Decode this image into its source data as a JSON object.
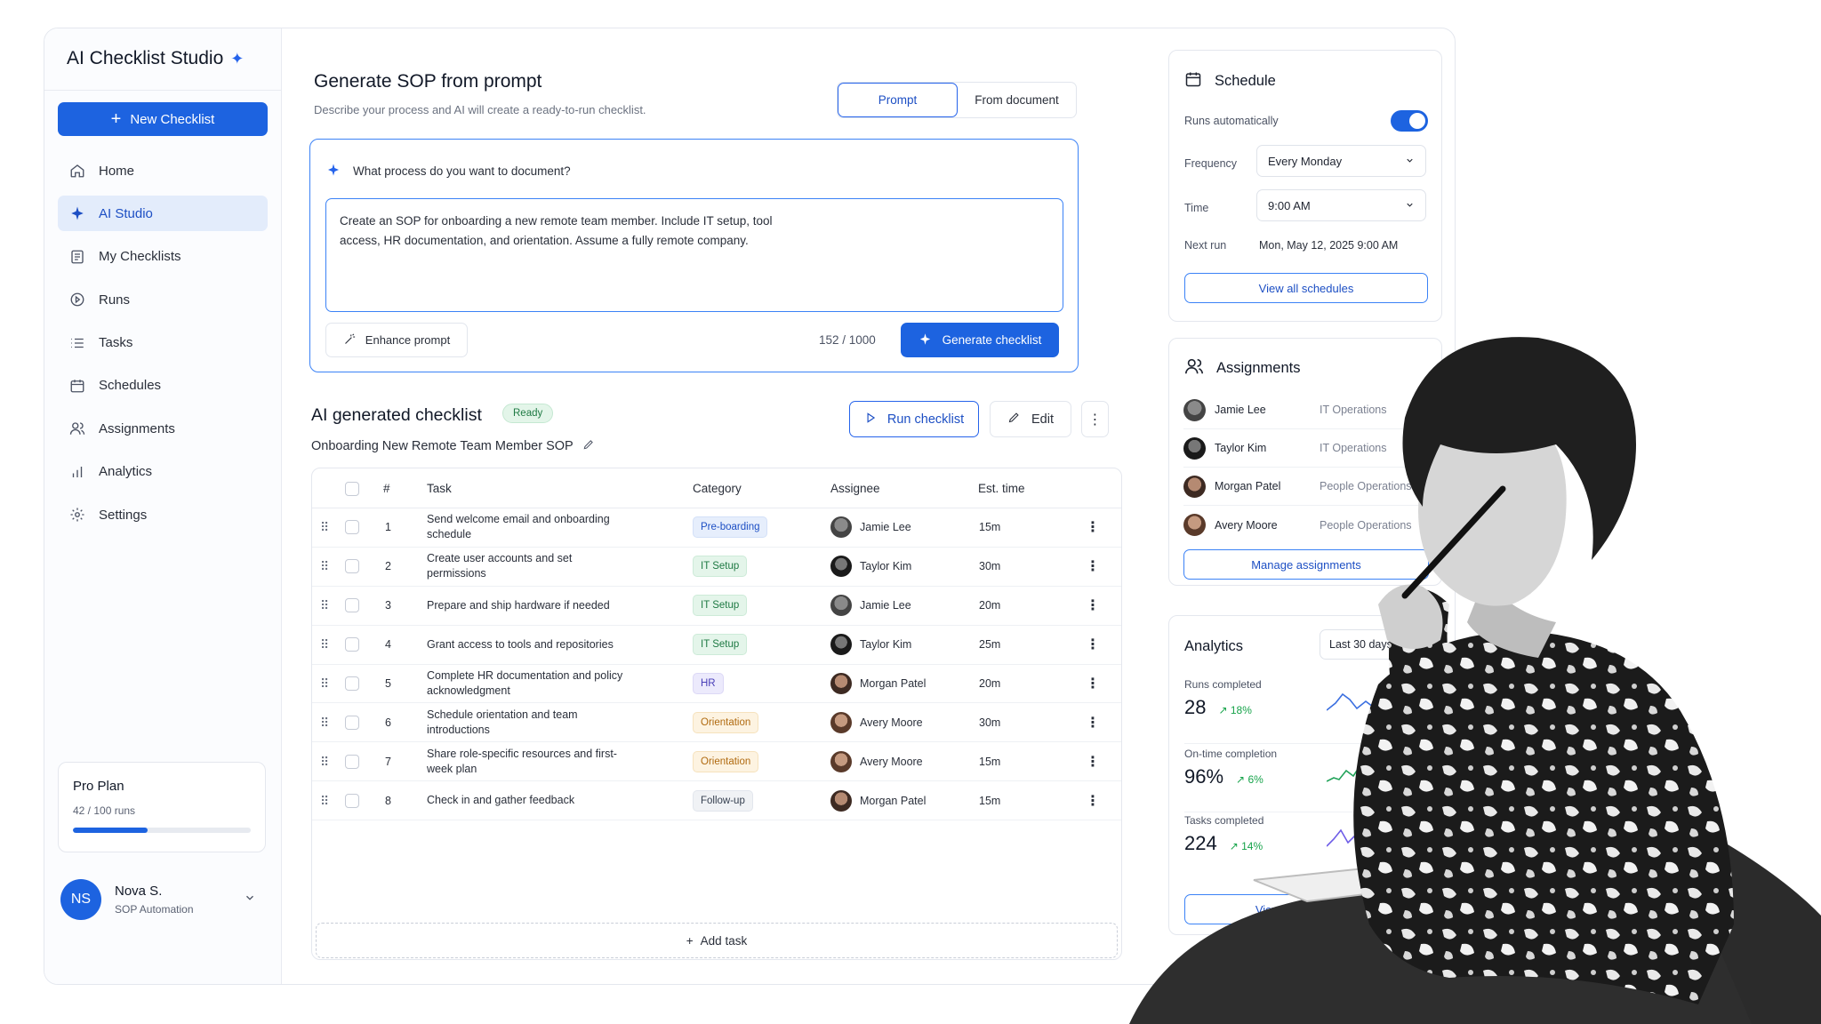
{
  "app": {
    "title": "AI Checklist Studio"
  },
  "sidebar": {
    "new_checklist": "New Checklist",
    "items": [
      {
        "label": "Home",
        "icon": "home-icon"
      },
      {
        "label": "AI Studio",
        "icon": "sparkle-icon",
        "active": true
      },
      {
        "label": "My Checklists",
        "icon": "checklist-icon"
      },
      {
        "label": "Runs",
        "icon": "play-circle-icon"
      },
      {
        "label": "Tasks",
        "icon": "list-icon"
      },
      {
        "label": "Schedules",
        "icon": "calendar-icon"
      },
      {
        "label": "Assignments",
        "icon": "users-icon"
      },
      {
        "label": "Analytics",
        "icon": "bar-chart-icon"
      },
      {
        "label": "Settings",
        "icon": "gear-icon"
      }
    ],
    "plan": {
      "name": "Pro Plan",
      "usage": "42 / 100 runs",
      "progress": 0.42
    },
    "user": {
      "initials": "NS",
      "name": "Nova S.",
      "role": "SOP Automation"
    }
  },
  "main": {
    "title": "Generate SOP from prompt",
    "subtitle": "Describe your process and AI will create a ready-to-run checklist.",
    "tabs": [
      "Prompt",
      "From document"
    ],
    "prompt": {
      "question": "What process do you want to document?",
      "text": "Create an SOP for onboarding a new remote team member. Include IT setup, tool\naccess, HR documentation, and orientation. Assume a fully remote company.",
      "enhance": "Enhance prompt",
      "counter": "152 / 1000",
      "generate": "Generate checklist"
    },
    "checklist": {
      "title": "AI generated checklist",
      "status": "Ready",
      "name": "Onboarding New Remote Team Member SOP",
      "run": "Run checklist",
      "edit": "Edit",
      "columns": [
        "#",
        "Task",
        "Category",
        "Assignee",
        "Est. time"
      ],
      "rows": [
        {
          "n": "1",
          "task": "Send welcome email and onboarding schedule",
          "category": "Pre-boarding",
          "cat": "pre",
          "assignee": "Jamie Lee",
          "time": "15m"
        },
        {
          "n": "2",
          "task": "Create user accounts and set permissions",
          "category": "IT Setup",
          "cat": "it",
          "assignee": "Taylor Kim",
          "time": "30m"
        },
        {
          "n": "3",
          "task": "Prepare and ship hardware if needed",
          "category": "IT Setup",
          "cat": "it",
          "assignee": "Jamie Lee",
          "time": "20m"
        },
        {
          "n": "4",
          "task": "Grant access to tools and repositories",
          "category": "IT Setup",
          "cat": "it",
          "assignee": "Taylor Kim",
          "time": "25m"
        },
        {
          "n": "5",
          "task": "Complete HR documentation and policy\nacknowledgment",
          "category": "HR",
          "cat": "hr",
          "assignee": "Morgan Patel",
          "time": "20m"
        },
        {
          "n": "6",
          "task": "Schedule orientation and team introductions",
          "category": "Orientation",
          "cat": "or",
          "assignee": "Avery Moore",
          "time": "30m"
        },
        {
          "n": "7",
          "task": "Share role-specific resources and first-week plan",
          "category": "Orientation",
          "cat": "or",
          "assignee": "Avery Moore",
          "time": "15m"
        },
        {
          "n": "8",
          "task": "Check in and gather feedback",
          "category": "Follow-up",
          "cat": "fu",
          "assignee": "Morgan Patel",
          "time": "15m"
        }
      ],
      "add_task": "Add task"
    }
  },
  "schedule": {
    "title": "Schedule",
    "auto_label": "Runs automatically",
    "auto_on": true,
    "frequency_label": "Frequency",
    "frequency": "Every Monday",
    "time_label": "Time",
    "time": "9:00 AM",
    "next_label": "Next run",
    "next": "Mon, May 12, 2025 9:00 AM",
    "view_all": "View all schedules"
  },
  "assignments": {
    "title": "Assignments",
    "people": [
      {
        "name": "Jamie Lee",
        "dept": "IT Operations"
      },
      {
        "name": "Taylor Kim",
        "dept": "IT Operations"
      },
      {
        "name": "Morgan Patel",
        "dept": "People Operations"
      },
      {
        "name": "Avery Moore",
        "dept": "People Operations"
      }
    ],
    "manage": "Manage assignments"
  },
  "analytics": {
    "title": "Analytics",
    "range": "Last 30 days",
    "metrics": [
      {
        "label": "Runs completed",
        "value": "28",
        "change": "18%",
        "color": "#3b6fe0"
      },
      {
        "label": "On-time completion",
        "value": "96%",
        "change": "6%",
        "color": "#22a35a"
      },
      {
        "label": "Tasks completed",
        "value": "224",
        "change": "14%",
        "color": "#6d5ce7"
      }
    ],
    "view_full": "View full analytics"
  },
  "colors": {
    "accent": "#1d63e0",
    "success": "#16a34a"
  }
}
